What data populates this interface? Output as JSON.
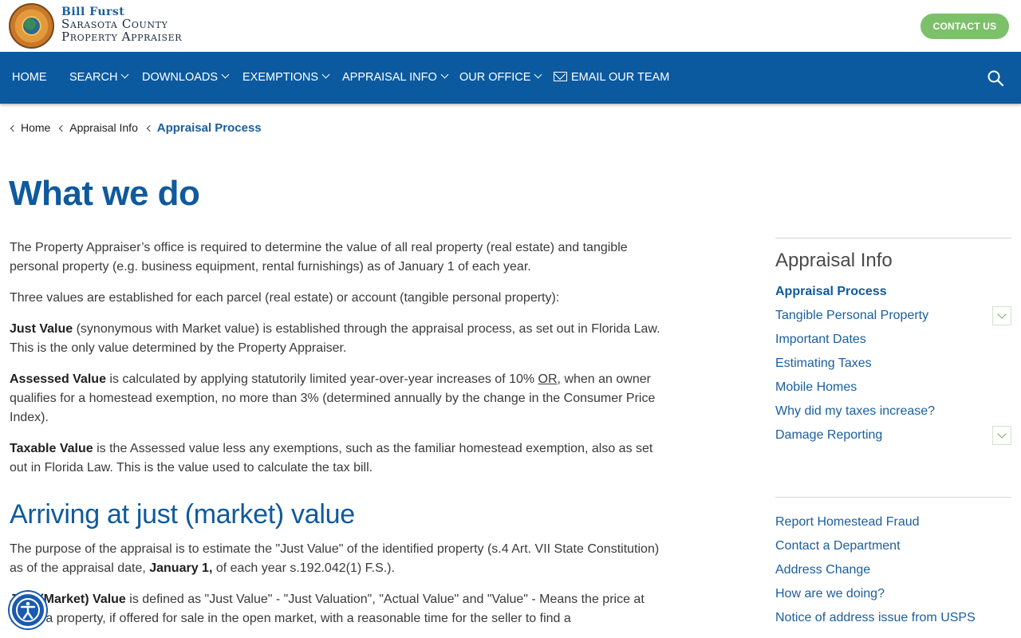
{
  "brand": {
    "line1": "Bill Furst",
    "line2": "Sarasota County",
    "line3": "Property Appraiser",
    "contact_label": "CONTACT US",
    "accent": "#0b5aa0",
    "button_green": "#7dc06a"
  },
  "nav": {
    "items": [
      {
        "label": "HOME"
      },
      {
        "label": "SEARCH"
      },
      {
        "label": "DOWNLOADS"
      },
      {
        "label": "EXEMPTIONS"
      },
      {
        "label": "APPRAISAL INFO"
      },
      {
        "label": "OUR OFFICE"
      },
      {
        "label": "EMAIL OUR TEAM"
      }
    ]
  },
  "breadcrumb": {
    "items": [
      "Home",
      "Appraisal Info",
      "Appraisal Process"
    ]
  },
  "page": {
    "title": "What we do",
    "p1": "The Property Appraiser’s office is required to determine the value of all real property (real estate) and tangible personal property (e.g. business equipment, rental furnishings) as of January 1 of each year.",
    "p2": "Three values are established for each parcel (real estate) or account (tangible personal property):",
    "p3_term": "Just Value",
    "p3_rest": " (synonymous with Market value) is established through the appraisal process, as set out in Florida Law. This is the only value determined by the Property Appraiser.",
    "p4_term": "Assessed Value",
    "p4_a": " is calculated by applying statutorily limited year-over-year increases of 10% ",
    "p4_or": "OR",
    "p4_b": ", when an owner qualifies for a homestead exemption, no more than 3% (determined annually by the change in the Consumer Price Index).",
    "p5_term": "Taxable Value",
    "p5_rest": " is the Assessed value less any exemptions, such as the familiar homestead exemption, also as set out in Florida Law.  This is the value used to calculate the tax bill.",
    "h2": "Arriving at just (market) value",
    "p6_a": "The purpose of the appraisal is to estimate the \"Just Value\" of the identified property (s.4 Art. VII State Constitution) as of the appraisal date, ",
    "p6_b": "January 1,",
    "p6_c": " of each year s.192.042(1) F.S.).",
    "p7_term": "Just (Market) Value",
    "p7_rest": " is defined as \"Just Value\" - \"Just Valuation\", \"Actual Value\" and \"Value\" - Means the price at which a property, if offered for sale in the open market, with a reasonable time for the seller to find a"
  },
  "sidebar": {
    "title": "Appraisal Info",
    "items": [
      {
        "label": "Appraisal Process"
      },
      {
        "label": "Tangible Personal Property"
      },
      {
        "label": "Important Dates"
      },
      {
        "label": "Estimating Taxes"
      },
      {
        "label": "Mobile Homes"
      },
      {
        "label": "Why did my taxes increase?"
      },
      {
        "label": "Damage Reporting"
      }
    ],
    "links": [
      {
        "label": "Report Homestead Fraud"
      },
      {
        "label": "Contact a Department"
      },
      {
        "label": "Address Change"
      },
      {
        "label": "How are we doing?"
      },
      {
        "label": "Notice of address issue from USPS"
      }
    ]
  }
}
